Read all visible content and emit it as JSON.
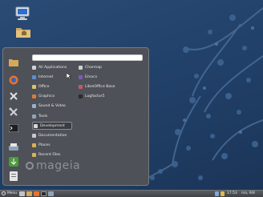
{
  "desktop": {
    "icons": [
      "computer-icon",
      "home-folder-icon"
    ]
  },
  "menu": {
    "favorites": [
      "file-manager-icon",
      "firefox-icon",
      "system-settings-icon",
      "tools-icon",
      "terminal-icon",
      "printer-icon",
      "install-icon",
      "files-icon"
    ],
    "search": {
      "value": ""
    },
    "categories": [
      {
        "label": "All Applications",
        "icon": "all-apps-icon",
        "color": "#cfd2d6"
      },
      {
        "label": "Internet",
        "icon": "internet-icon",
        "color": "#5b8fd6"
      },
      {
        "label": "Office",
        "icon": "office-icon",
        "color": "#d9c26a"
      },
      {
        "label": "Graphics",
        "icon": "graphics-icon",
        "color": "#e27a3a"
      },
      {
        "label": "Sound & Video",
        "icon": "sound-video-icon",
        "color": "#9bb0c8"
      },
      {
        "label": "Tools",
        "icon": "tools-icon",
        "color": "#8fa4b8"
      },
      {
        "label": "Development",
        "icon": "development-icon",
        "color": "#d8d8d8"
      },
      {
        "label": "Documentation",
        "icon": "documentation-icon",
        "color": "#c9c9c9"
      },
      {
        "label": "Places",
        "icon": "places-icon",
        "color": "#d8b25a"
      },
      {
        "label": "Recent Files",
        "icon": "recent-files-icon",
        "color": "#d8b25a"
      }
    ],
    "selected_category": "Development",
    "apps": [
      {
        "label": "Charmap",
        "icon": "charmap-icon",
        "color": "#cfcfcf"
      },
      {
        "label": "Emacs",
        "icon": "emacs-icon",
        "color": "#7a5bb8"
      },
      {
        "label": "LibreOffice Base",
        "icon": "libreoffice-base-icon",
        "color": "#c35a6a"
      },
      {
        "label": "Logfactor5",
        "icon": "logfactor-icon",
        "color": "#2a2a2a"
      }
    ],
    "logo_text": "mageia"
  },
  "panel": {
    "menu_label": "Menu",
    "clock": "17:53",
    "date": "ma, 9/8"
  },
  "colors": {
    "accent": "#2a4b75",
    "menu_bg": "#4e5157"
  }
}
